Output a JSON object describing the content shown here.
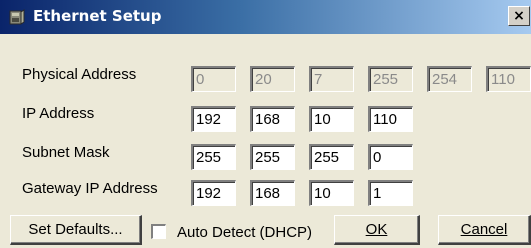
{
  "window": {
    "title": "Ethernet Setup",
    "close_glyph": "×"
  },
  "rows": [
    {
      "label": "Physical Address",
      "fields": [
        "0",
        "20",
        "7",
        "255",
        "254",
        "110"
      ],
      "enabled": false
    },
    {
      "label": "IP Address",
      "fields": [
        "192",
        "168",
        "10",
        "110"
      ],
      "enabled": true
    },
    {
      "label": "Subnet Mask",
      "fields": [
        "255",
        "255",
        "255",
        "0"
      ],
      "enabled": true
    },
    {
      "label": "Gateway IP Address",
      "fields": [
        "192",
        "168",
        "10",
        "1"
      ],
      "enabled": true
    }
  ],
  "footer": {
    "set_defaults_label": "Set Defaults...",
    "auto_detect_label": "Auto Detect (DHCP)",
    "auto_detect_checked": false,
    "ok_label": "OK",
    "cancel_label": "Cancel"
  },
  "icons": {
    "title_icon": "ethernet-setup-icon"
  }
}
